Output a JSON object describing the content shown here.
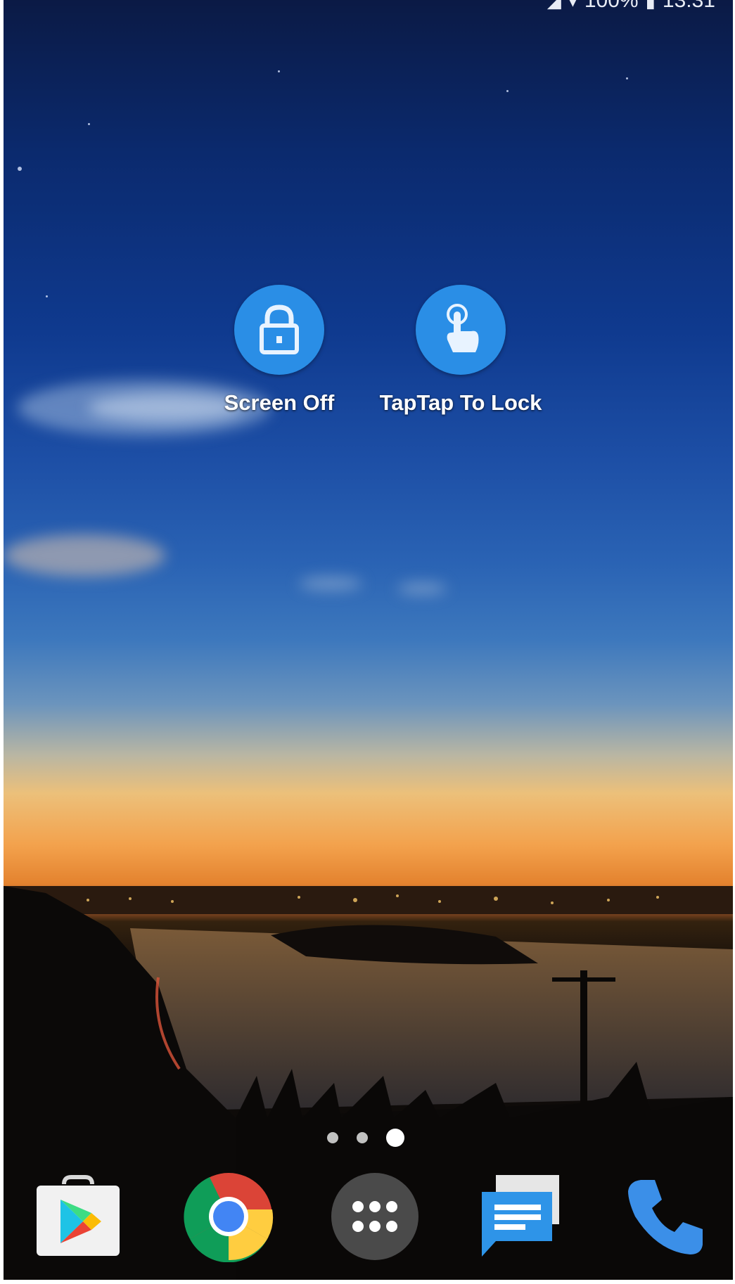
{
  "status_bar": {
    "battery_percent": "100%",
    "time": "13:31",
    "icons": [
      "signal-icon",
      "wifi-icon",
      "battery-icon"
    ]
  },
  "shortcuts": [
    {
      "label": "Screen Off",
      "icon": "lock-icon",
      "color": "#2a8ee6"
    },
    {
      "label": "TapTap To Lock",
      "icon": "touch-hand-icon",
      "color": "#2a8ee6"
    }
  ],
  "page_indicator": {
    "pages": 3,
    "current": 3
  },
  "dock": {
    "apps": [
      {
        "name": "play-store",
        "icon": "play-store-icon"
      },
      {
        "name": "chrome",
        "icon": "chrome-icon"
      },
      {
        "name": "app-drawer",
        "icon": "app-drawer-icon"
      },
      {
        "name": "messages",
        "icon": "messages-icon"
      },
      {
        "name": "phone",
        "icon": "phone-icon"
      }
    ]
  }
}
